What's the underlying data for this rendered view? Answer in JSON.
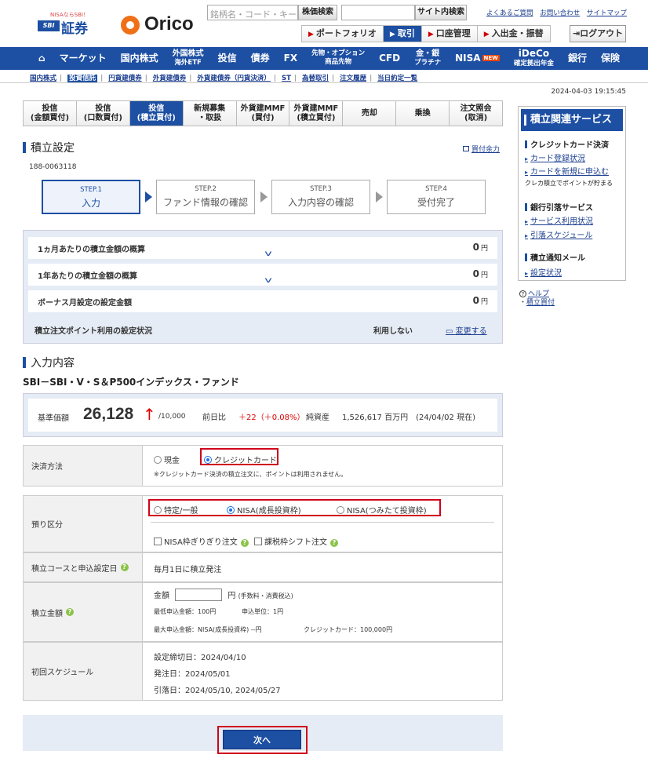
{
  "header": {
    "sbi_tagline": "NISAならSBI！",
    "sbi_mark": "SBI",
    "sbi_name": "証券",
    "orico_name": "Orico",
    "search_placeholder": "銘柄名・コード・キーワード",
    "stock_search_label": "株価検索",
    "site_search_label": "サイト内検索",
    "links": [
      "よくあるご質問",
      "お問い合わせ",
      "サイトマップ"
    ],
    "subnav": [
      "ポートフォリオ",
      "取引",
      "口座管理",
      "入出金・振替"
    ],
    "subnav_active": "取引",
    "logout_label": "ログアウト"
  },
  "global_nav": {
    "home_icon": "home-icon",
    "items": [
      "マーケット",
      "国内株式",
      "外国株式",
      "海外ETF",
      "投信",
      "債券",
      "FX",
      "先物・オプション",
      "商品先物",
      "CFD",
      "金・銀",
      "プラチナ",
      "NISA",
      "NEW",
      "iDeCo",
      "確定拠出年金",
      "銀行",
      "保険"
    ]
  },
  "text_nav": [
    "国内株式",
    "投資信託",
    "円貨建債券",
    "外貨建債券",
    "外貨建債券（円貨決済）",
    "ST",
    "為替取引",
    "注文履歴",
    "当日約定一覧"
  ],
  "datetime": "2024-04-03 19:15:45",
  "tabs": [
    {
      "l1": "投信",
      "l2": "(金額買付)"
    },
    {
      "l1": "投信",
      "l2": "(口数買付)"
    },
    {
      "l1": "投信",
      "l2": "(積立買付)"
    },
    {
      "l1": "新規募集",
      "l2": "・取扱"
    },
    {
      "l1": "外貨建MMF",
      "l2": "(買付)"
    },
    {
      "l1": "外貨建MMF",
      "l2": "(積立買付)"
    },
    {
      "l1": "売却",
      "l2": ""
    },
    {
      "l1": "乗換",
      "l2": ""
    },
    {
      "l1": "注文照会",
      "l2": "(取消)"
    }
  ],
  "section_title": "積立設定",
  "kaitsuke_link": "買付余力",
  "account_no": "188-0063118",
  "steps": [
    {
      "num": "STEP.1",
      "label": "入力"
    },
    {
      "num": "STEP.2",
      "label": "ファンド情報の確認"
    },
    {
      "num": "STEP.3",
      "label": "入力内容の確認"
    },
    {
      "num": "STEP.4",
      "label": "受付完了"
    }
  ],
  "summary": {
    "monthly_label": "1ヵ月あたりの積立金額の概算",
    "monthly_value": "0",
    "yearly_label": "1年あたりの積立金額の概算",
    "yearly_value": "0",
    "bonus_label": "ボーナス月設定の設定金額",
    "bonus_value": "0",
    "yen": "円",
    "point_label": "積立注文ポイント利用の設定状況",
    "point_value": "利用しない",
    "change_link": "変更する"
  },
  "input_title": "入力内容",
  "fund_name": "SBI－SBI・V・S＆P500インデックス・ファンド",
  "price": {
    "label": "基準価額",
    "value": "26,128",
    "unit": "/10,000",
    "diff_label": "前日比",
    "diff_value": "＋22（＋0.08%）",
    "nav_label": "純資産",
    "nav_value": "1,526,617 百万円　(24/04/02 現在)"
  },
  "form": {
    "payment_label": "決済方法",
    "payment_options": [
      "現金",
      "クレジットカード"
    ],
    "payment_selected": "クレジットカード",
    "payment_note": "※クレジットカード決済の積立注文に、ポイントは利用されません。",
    "account_type_label": "預り区分",
    "account_type_options": [
      "特定/一般",
      "NISA(成長投資枠)",
      "NISA(つみたて投資枠)"
    ],
    "account_type_selected": "NISA(成長投資枠)",
    "nisa_limit_label": "NISA枠ぎりぎり注文",
    "tax_shift_label": "課税枠シフト注文",
    "course_label": "積立コースと申込設定日",
    "course_value": "毎月1日に積立発注",
    "amount_label": "積立金額",
    "amount_prefix": "金額",
    "amount_value": "",
    "amount_unit": "円",
    "amount_fee_note": "(手数料・消費税込)",
    "min_amount": "最低申込金額：100円",
    "unit_amount": "申込単位：1円",
    "max_amount": "最大申込金額：NISA(成長投資枠) --円",
    "credit_max": "クレジットカード：100,000円",
    "schedule_label": "初回スケジュール",
    "schedule_lines": [
      "設定締切日：2024/04/10",
      "発注日：2024/05/01",
      "引落日：2024/05/10, 2024/05/27"
    ]
  },
  "next_button": "次へ",
  "sidebar": {
    "title": "積立関連サービス",
    "group1": "クレジットカード決済",
    "g1_items": [
      "カード登録状況",
      "カードを新規に申込む"
    ],
    "g1_note": "クレカ積立でポイントが貯まる",
    "group2": "銀行引落サービス",
    "g2_items": [
      "サービス利用状況",
      "引落スケジュール"
    ],
    "group3": "積立通知メール",
    "g3_items": [
      "設定状況"
    ],
    "help_label": "ヘルプ",
    "help_item": "積立買付"
  },
  "colors": {
    "brand_blue": "#1d4fa3",
    "orico_orange": "#f07018",
    "highlight_red": "#d0021b",
    "up_red": "#dd0000"
  }
}
